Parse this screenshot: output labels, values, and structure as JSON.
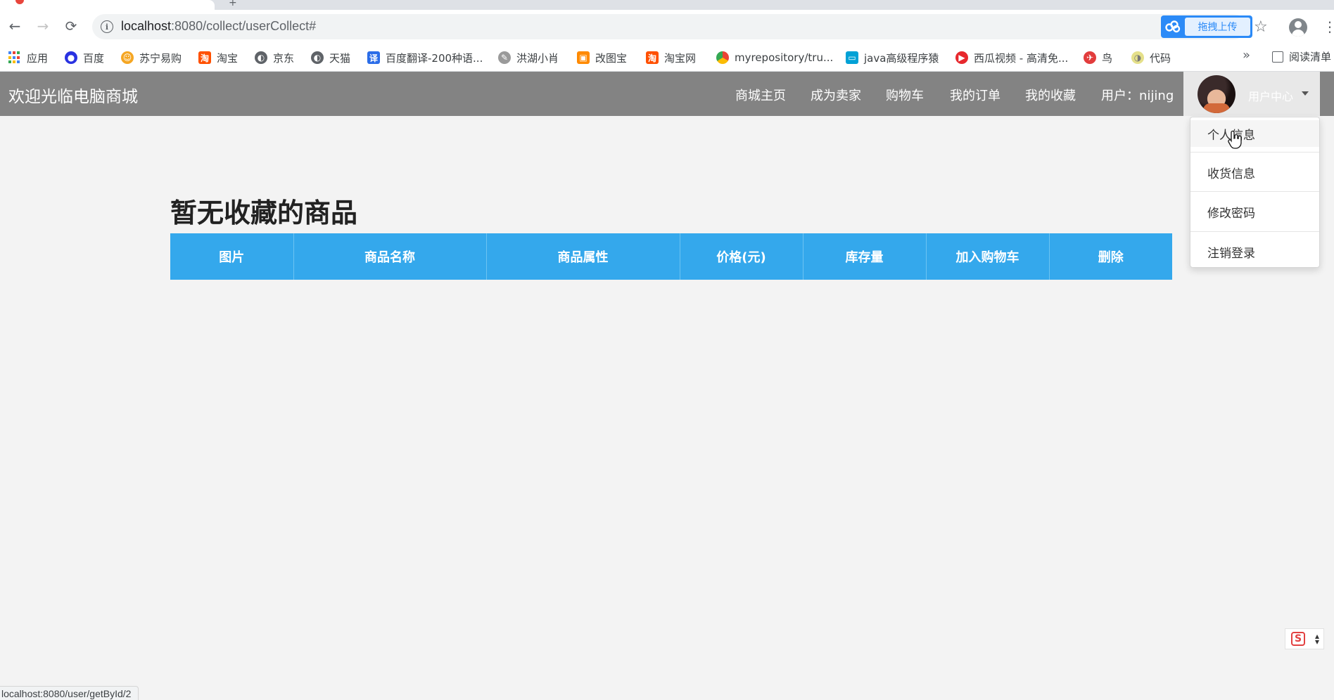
{
  "browser": {
    "url_host": "localhost",
    "url_path": ":8080/collect/userCollect#",
    "cloud_upload_label": "拖拽上传",
    "status_url": "localhost:8080/user/getById/2",
    "bookmarks": [
      {
        "label": "应用",
        "icon": "apps-grid-icon"
      },
      {
        "label": "百度",
        "icon": "baidu-paw-icon",
        "color": "#2932e1"
      },
      {
        "label": "苏宁易购",
        "icon": "suning-icon",
        "color": "#f5a623"
      },
      {
        "label": "淘宝",
        "icon": "taobao-icon",
        "color": "#ff5000"
      },
      {
        "label": "京东",
        "icon": "globe-icon",
        "color": "#5f6368"
      },
      {
        "label": "天猫",
        "icon": "globe-icon",
        "color": "#5f6368"
      },
      {
        "label": "百度翻译-200种语...",
        "icon": "translate-icon",
        "color": "#2b6de8"
      },
      {
        "label": "洪湖小肖",
        "icon": "bird-icon",
        "color": "#888888"
      },
      {
        "label": "改图宝",
        "icon": "gaitubao-icon",
        "color": "#ff8a00"
      },
      {
        "label": "淘宝网",
        "icon": "taobao-icon",
        "color": "#ff5000"
      },
      {
        "label": "myrepository/tru...",
        "icon": "chrome-icon",
        "color": "#34a853"
      },
      {
        "label": "java高级程序猿",
        "icon": "bilibili-icon",
        "color": "#00a1d6"
      },
      {
        "label": "西瓜视频 - 高清免...",
        "icon": "xigua-icon",
        "color": "#e7282d"
      },
      {
        "label": "鸟",
        "icon": "bird-red-icon",
        "color": "#e23c3c"
      },
      {
        "label": "代码",
        "icon": "code-icon",
        "color": "#e5e08a"
      }
    ],
    "more_label": "»",
    "reading_list_label": "阅读清单"
  },
  "navbar": {
    "brand": "欢迎光临电脑商城",
    "links": [
      "商城主页",
      "成为卖家",
      "购物车",
      "我的订单",
      "我的收藏"
    ],
    "user_label": "用户：nijing",
    "user_center_label": "用户中心"
  },
  "dropdown": {
    "items": [
      "个人信息",
      "收货信息",
      "修改密码",
      "注销登录"
    ]
  },
  "main": {
    "title": "暂无收藏的商品",
    "table_headers": [
      "图片",
      "商品名称",
      "商品属性",
      "价格(元)",
      "库存量",
      "加入购物车",
      "删除"
    ]
  },
  "colors": {
    "navbar": "#838383",
    "table_header": "#34a8ec",
    "page_bg": "#f3f3f3"
  }
}
